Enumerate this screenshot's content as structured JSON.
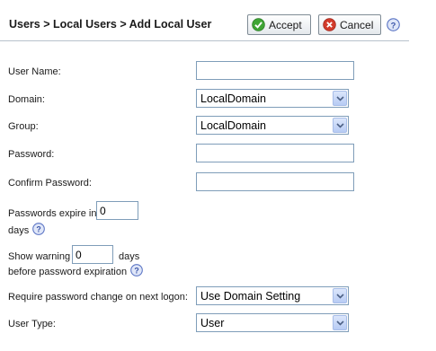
{
  "header": {
    "breadcrumb": "Users > Local Users > Add Local User",
    "accept_label": "Accept",
    "cancel_label": "Cancel"
  },
  "form": {
    "user_name_label": "User Name:",
    "user_name_value": "",
    "domain_label": "Domain:",
    "domain_value": "LocalDomain",
    "group_label": "Group:",
    "group_value": "LocalDomain",
    "password_label": "Password:",
    "password_value": "",
    "confirm_password_label": "Confirm Password:",
    "confirm_password_value": "",
    "expire_prefix": "Passwords expire in",
    "expire_value": "0",
    "expire_suffix": "days",
    "warning_prefix": "Show warning",
    "warning_value": "0",
    "warning_days": "days",
    "warning_suffix": "before password expiration",
    "require_change_label": "Require password change on next logon:",
    "require_change_value": "Use Domain Setting",
    "user_type_label": "User Type:",
    "user_type_value": "User"
  },
  "colors": {
    "accept_icon": "#3fa535",
    "cancel_icon": "#d23b2b",
    "help_icon": "#5a74c4",
    "header_rule": "#b8c2cc",
    "input_border": "#7f9db9"
  },
  "icons": {
    "accept": "check-circle-icon",
    "cancel": "x-circle-icon",
    "help": "help-question-icon",
    "dropdown": "chevron-down-icon"
  }
}
